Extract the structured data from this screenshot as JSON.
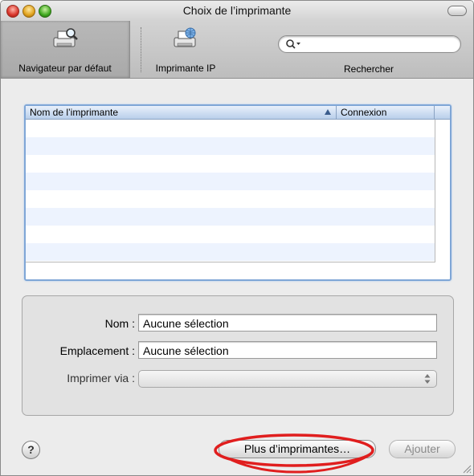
{
  "window": {
    "title": "Choix de l’imprimante"
  },
  "toolbar": {
    "items": [
      {
        "label": "Navigateur par défaut",
        "icon": "printer-search-icon",
        "selected": true
      },
      {
        "label": "Imprimante IP",
        "icon": "printer-network-icon",
        "selected": false
      }
    ],
    "search": {
      "value": "",
      "placeholder": "",
      "label": "Rechercher"
    }
  },
  "printer_list": {
    "columns": [
      "Nom de l’imprimante",
      "Connexion"
    ],
    "rows": []
  },
  "details": {
    "name_label": "Nom :",
    "name_value": "Aucune sélection",
    "location_label": "Emplacement :",
    "location_value": "Aucune sélection",
    "print_via_label": "Imprimer via :",
    "print_via_value": ""
  },
  "buttons": {
    "help": "?",
    "more_printers": "Plus d’imprimantes…",
    "add": "Ajouter"
  },
  "colors": {
    "selection_border": "#7fa6d6",
    "row_stripe": "#edf3fe",
    "annotation": "#e01e1e"
  }
}
